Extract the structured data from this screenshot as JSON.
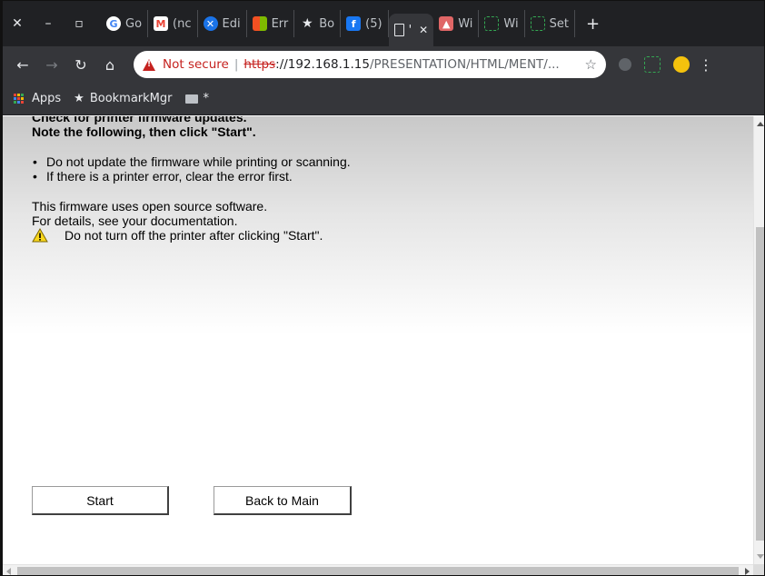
{
  "browser": {
    "tabs": [
      {
        "label": "Go",
        "favicon": "google-icon",
        "color": "#4285f4"
      },
      {
        "label": "(nc",
        "favicon": "gmail-icon",
        "color": "#ea4335"
      },
      {
        "label": "Edi",
        "favicon": "edit-icon",
        "color": "#1a73e8"
      },
      {
        "label": "Err",
        "favicon": "windows-icon",
        "color": "#f25022"
      },
      {
        "label": "Bo",
        "favicon": "bookmark-star-icon",
        "color": "#e8eaed"
      },
      {
        "label": "(5)",
        "favicon": "facebook-icon",
        "color": "#1877f2"
      },
      {
        "label": "'",
        "favicon": "page-icon",
        "color": "#e8eaed"
      },
      {
        "label": "Wi",
        "favicon": "wiki-icon",
        "color": "#e06666"
      },
      {
        "label": "Wi",
        "favicon": "frame-icon",
        "color": "#34a853"
      },
      {
        "label": "Set",
        "favicon": "frame-icon",
        "color": "#34a853"
      }
    ],
    "url": {
      "security_label": "Not secure",
      "scheme": "https",
      "host": "://192.168.1.15",
      "path": "/PRESENTATION/HTML/MENT/..."
    },
    "bookmarks": {
      "apps": "Apps",
      "bookmark_mgr": "BookmarkMgr",
      "folder": "*"
    }
  },
  "page": {
    "clipped_heading": "Check for printer firmware updates.",
    "instruction": "Note the following, then click \"Start\".",
    "notes": [
      "Do not update the firmware while printing or scanning.",
      "If there is a printer error, clear the error first."
    ],
    "info_line1": "This firmware uses open source software.",
    "info_line2": "For details, see your documentation.",
    "warning": "Do not turn off the printer after clicking \"Start\".",
    "start_label": "Start",
    "back_label": "Back to Main"
  },
  "colors": {
    "tab_strip": "#202124",
    "toolbar": "#35363a",
    "not_secure": "#c5221f",
    "warning_yellow": "#f9d71c"
  }
}
